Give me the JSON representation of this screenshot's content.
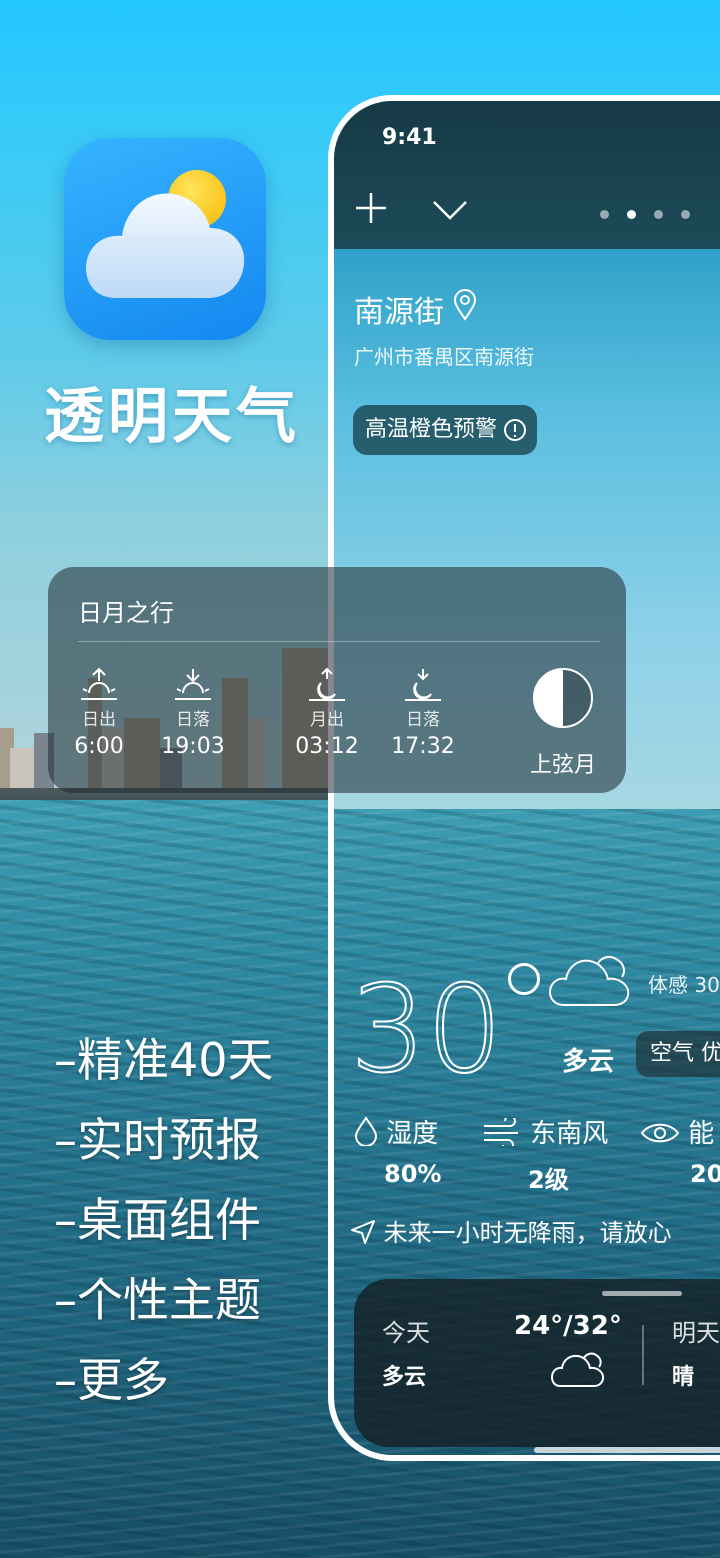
{
  "promo": {
    "app_name": "透明天气",
    "features": [
      "–精准40天",
      "–实时预报",
      "–桌面组件",
      "–个性主题",
      "–更多"
    ]
  },
  "sun_moon": {
    "title": "日月之行",
    "items": [
      {
        "icon": "sunrise-icon",
        "label": "日出",
        "time": "6:00"
      },
      {
        "icon": "sunset-icon",
        "label": "日落",
        "time": "19:03"
      },
      {
        "icon": "moonrise-icon",
        "label": "月出",
        "time": "03:12"
      },
      {
        "icon": "moonset-icon",
        "label": "日落",
        "time": "17:32"
      }
    ],
    "moon_phase": "上弦月"
  },
  "phone": {
    "status_time": "9:41",
    "location": {
      "name": "南源街",
      "sub": "广州市番禺区南源街"
    },
    "alert": "高温橙色预警",
    "current": {
      "temperature": "30",
      "feels_like": "体感 30",
      "condition": "多云",
      "air_quality": "空气 优"
    },
    "metrics": [
      {
        "icon": "humidity-icon",
        "label": "湿度",
        "value": "80%"
      },
      {
        "icon": "wind-icon",
        "label": "东南风",
        "value": "2级"
      },
      {
        "icon": "visibility-icon",
        "label": "能",
        "value": "20"
      }
    ],
    "rain_note": "未来一小时无降雨，请放心",
    "forecast": {
      "today_label": "今天",
      "today_condition": "多云",
      "today_range": "24°/32°",
      "tomorrow_label": "明天",
      "tomorrow_condition": "晴"
    }
  },
  "colors": {
    "accent": "#1487f0",
    "sun": "#f7b705",
    "card": "#1e2d32"
  }
}
